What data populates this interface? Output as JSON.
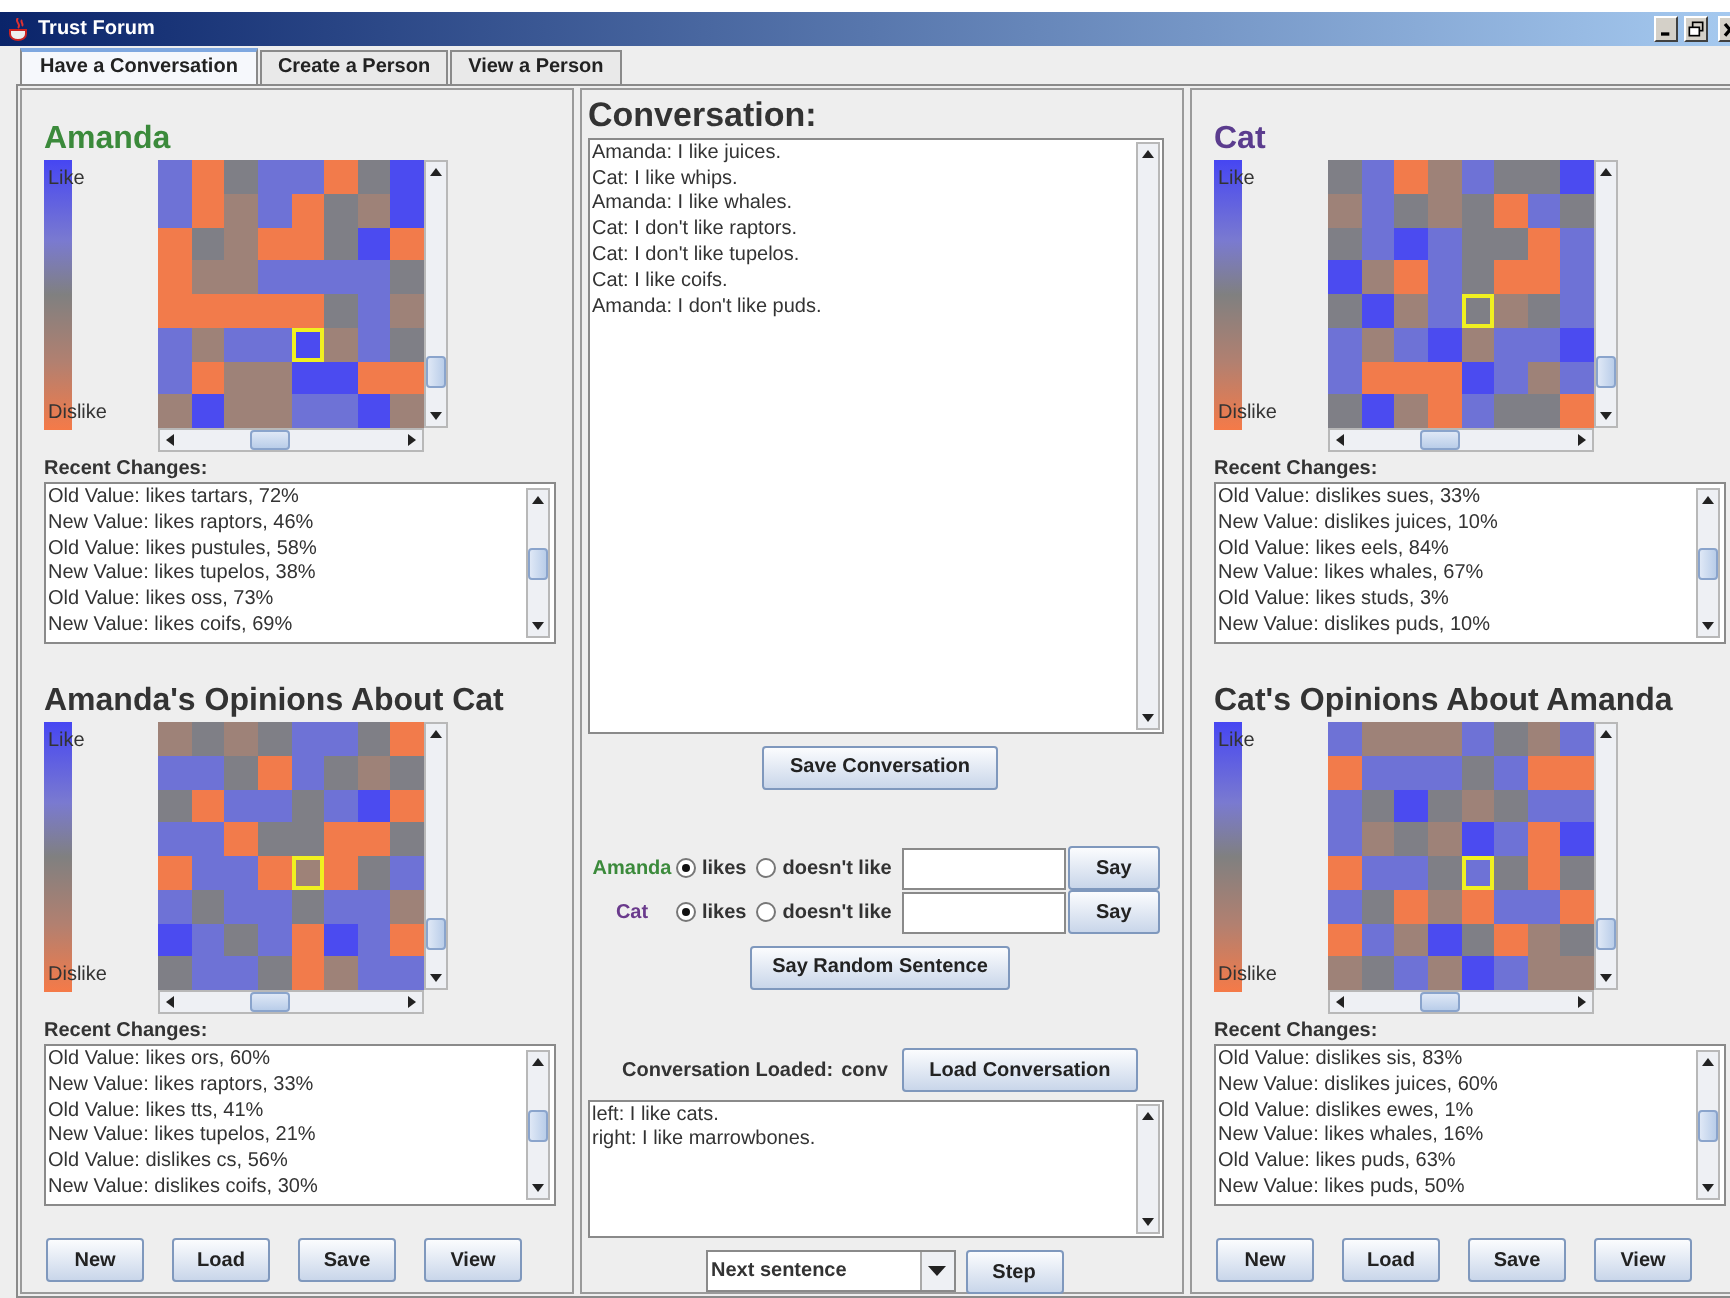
{
  "window": {
    "title": "Trust Forum"
  },
  "tabs": [
    {
      "label": "Have a Conversation",
      "selected": true
    },
    {
      "label": "Create a Person",
      "selected": false
    },
    {
      "label": "View a Person",
      "selected": false
    }
  ],
  "left_panel": {
    "color": "#3b8a3b",
    "sections": [
      {
        "kind": "self",
        "title": "Amanda",
        "legend": {
          "top": "Like",
          "bottom": "Dislike"
        },
        "grid": [
          {
            "cells": [
              {
                "color": "#6e72d6",
                "selected": false
              },
              {
                "color": "#f27b4b",
                "selected": false
              },
              {
                "color": "#7f7f86",
                "selected": false
              },
              {
                "color": "#6e72d6",
                "selected": false
              },
              {
                "color": "#6e72d6",
                "selected": false
              },
              {
                "color": "#f27b4b",
                "selected": false
              },
              {
                "color": "#7f7f86",
                "selected": false
              },
              {
                "color": "#4b4bf0",
                "selected": false
              }
            ]
          },
          {
            "cells": [
              {
                "color": "#6e72d6",
                "selected": false
              },
              {
                "color": "#f27b4b",
                "selected": false
              },
              {
                "color": "#9e8278",
                "selected": false
              },
              {
                "color": "#6e72d6",
                "selected": false
              },
              {
                "color": "#f27b4b",
                "selected": false
              },
              {
                "color": "#7f7f86",
                "selected": false
              },
              {
                "color": "#9e8278",
                "selected": false
              },
              {
                "color": "#4b4bf0",
                "selected": false
              }
            ]
          },
          {
            "cells": [
              {
                "color": "#f27b4b",
                "selected": false
              },
              {
                "color": "#7f7f86",
                "selected": false
              },
              {
                "color": "#9e8278",
                "selected": false
              },
              {
                "color": "#f27b4b",
                "selected": false
              },
              {
                "color": "#f27b4b",
                "selected": false
              },
              {
                "color": "#7f7f86",
                "selected": false
              },
              {
                "color": "#4b4bf0",
                "selected": false
              },
              {
                "color": "#f27b4b",
                "selected": false
              }
            ]
          },
          {
            "cells": [
              {
                "color": "#f27b4b",
                "selected": false
              },
              {
                "color": "#9e8278",
                "selected": false
              },
              {
                "color": "#9e8278",
                "selected": false
              },
              {
                "color": "#6e72d6",
                "selected": false
              },
              {
                "color": "#6e72d6",
                "selected": false
              },
              {
                "color": "#6e72d6",
                "selected": false
              },
              {
                "color": "#6e72d6",
                "selected": false
              },
              {
                "color": "#7f7f86",
                "selected": false
              }
            ]
          },
          {
            "cells": [
              {
                "color": "#f27b4b",
                "selected": false
              },
              {
                "color": "#f27b4b",
                "selected": false
              },
              {
                "color": "#f27b4b",
                "selected": false
              },
              {
                "color": "#f27b4b",
                "selected": false
              },
              {
                "color": "#f27b4b",
                "selected": false
              },
              {
                "color": "#7f7f86",
                "selected": false
              },
              {
                "color": "#6e72d6",
                "selected": false
              },
              {
                "color": "#9e8278",
                "selected": false
              }
            ]
          },
          {
            "cells": [
              {
                "color": "#6e72d6",
                "selected": false
              },
              {
                "color": "#9e8278",
                "selected": false
              },
              {
                "color": "#6e72d6",
                "selected": false
              },
              {
                "color": "#6e72d6",
                "selected": false
              },
              {
                "color": "#4b4bf0",
                "selected": true
              },
              {
                "color": "#9e8278",
                "selected": false
              },
              {
                "color": "#6e72d6",
                "selected": false
              },
              {
                "color": "#7f7f86",
                "selected": false
              }
            ]
          },
          {
            "cells": [
              {
                "color": "#6e72d6",
                "selected": false
              },
              {
                "color": "#f27b4b",
                "selected": false
              },
              {
                "color": "#9e8278",
                "selected": false
              },
              {
                "color": "#9e8278",
                "selected": false
              },
              {
                "color": "#4b4bf0",
                "selected": false
              },
              {
                "color": "#4b4bf0",
                "selected": false
              },
              {
                "color": "#f27b4b",
                "selected": false
              },
              {
                "color": "#f27b4b",
                "selected": false
              }
            ]
          },
          {
            "cells": [
              {
                "color": "#9e8278",
                "selected": false
              },
              {
                "color": "#4b4bf0",
                "selected": false
              },
              {
                "color": "#9e8278",
                "selected": false
              },
              {
                "color": "#9e8278",
                "selected": false
              },
              {
                "color": "#6e72d6",
                "selected": false
              },
              {
                "color": "#6e72d6",
                "selected": false
              },
              {
                "color": "#4b4bf0",
                "selected": false
              },
              {
                "color": "#9e8278",
                "selected": false
              }
            ]
          }
        ],
        "changes_label": "Recent Changes:",
        "changes": [
          "Old Value: likes tartars, 72%",
          "New Value: likes raptors, 46%",
          "Old Value: likes pustules, 58%",
          "New Value: likes tupelos, 38%",
          "Old Value: likes oss, 73%",
          "New Value: likes coifs, 69%"
        ]
      },
      {
        "kind": "opinions",
        "title": "Amanda's Opinions About Cat",
        "legend": {
          "top": "Like",
          "bottom": "Dislike"
        },
        "grid": [
          {
            "cells": [
              {
                "color": "#9e8278",
                "selected": false
              },
              {
                "color": "#7f7f86",
                "selected": false
              },
              {
                "color": "#9e8278",
                "selected": false
              },
              {
                "color": "#7f7f86",
                "selected": false
              },
              {
                "color": "#6e72d6",
                "selected": false
              },
              {
                "color": "#6e72d6",
                "selected": false
              },
              {
                "color": "#7f7f86",
                "selected": false
              },
              {
                "color": "#f27b4b",
                "selected": false
              }
            ]
          },
          {
            "cells": [
              {
                "color": "#6e72d6",
                "selected": false
              },
              {
                "color": "#6e72d6",
                "selected": false
              },
              {
                "color": "#7f7f86",
                "selected": false
              },
              {
                "color": "#f27b4b",
                "selected": false
              },
              {
                "color": "#6e72d6",
                "selected": false
              },
              {
                "color": "#7f7f86",
                "selected": false
              },
              {
                "color": "#9e8278",
                "selected": false
              },
              {
                "color": "#7f7f86",
                "selected": false
              }
            ]
          },
          {
            "cells": [
              {
                "color": "#7f7f86",
                "selected": false
              },
              {
                "color": "#f27b4b",
                "selected": false
              },
              {
                "color": "#6e72d6",
                "selected": false
              },
              {
                "color": "#6e72d6",
                "selected": false
              },
              {
                "color": "#7f7f86",
                "selected": false
              },
              {
                "color": "#6e72d6",
                "selected": false
              },
              {
                "color": "#4b4bf0",
                "selected": false
              },
              {
                "color": "#f27b4b",
                "selected": false
              }
            ]
          },
          {
            "cells": [
              {
                "color": "#6e72d6",
                "selected": false
              },
              {
                "color": "#6e72d6",
                "selected": false
              },
              {
                "color": "#f27b4b",
                "selected": false
              },
              {
                "color": "#7f7f86",
                "selected": false
              },
              {
                "color": "#7f7f86",
                "selected": false
              },
              {
                "color": "#f27b4b",
                "selected": false
              },
              {
                "color": "#f27b4b",
                "selected": false
              },
              {
                "color": "#7f7f86",
                "selected": false
              }
            ]
          },
          {
            "cells": [
              {
                "color": "#f27b4b",
                "selected": false
              },
              {
                "color": "#6e72d6",
                "selected": false
              },
              {
                "color": "#6e72d6",
                "selected": false
              },
              {
                "color": "#f27b4b",
                "selected": false
              },
              {
                "color": "#9e8278",
                "selected": true
              },
              {
                "color": "#f27b4b",
                "selected": false
              },
              {
                "color": "#7f7f86",
                "selected": false
              },
              {
                "color": "#6e72d6",
                "selected": false
              }
            ]
          },
          {
            "cells": [
              {
                "color": "#6e72d6",
                "selected": false
              },
              {
                "color": "#7f7f86",
                "selected": false
              },
              {
                "color": "#6e72d6",
                "selected": false
              },
              {
                "color": "#6e72d6",
                "selected": false
              },
              {
                "color": "#7f7f86",
                "selected": false
              },
              {
                "color": "#6e72d6",
                "selected": false
              },
              {
                "color": "#6e72d6",
                "selected": false
              },
              {
                "color": "#9e8278",
                "selected": false
              }
            ]
          },
          {
            "cells": [
              {
                "color": "#4b4bf0",
                "selected": false
              },
              {
                "color": "#6e72d6",
                "selected": false
              },
              {
                "color": "#7f7f86",
                "selected": false
              },
              {
                "color": "#6e72d6",
                "selected": false
              },
              {
                "color": "#f27b4b",
                "selected": false
              },
              {
                "color": "#4b4bf0",
                "selected": false
              },
              {
                "color": "#6e72d6",
                "selected": false
              },
              {
                "color": "#f27b4b",
                "selected": false
              }
            ]
          },
          {
            "cells": [
              {
                "color": "#7f7f86",
                "selected": false
              },
              {
                "color": "#6e72d6",
                "selected": false
              },
              {
                "color": "#6e72d6",
                "selected": false
              },
              {
                "color": "#7f7f86",
                "selected": false
              },
              {
                "color": "#f27b4b",
                "selected": false
              },
              {
                "color": "#9e8278",
                "selected": false
              },
              {
                "color": "#6e72d6",
                "selected": false
              },
              {
                "color": "#6e72d6",
                "selected": false
              }
            ]
          }
        ],
        "changes_label": "Recent Changes:",
        "changes": [
          "Old Value: likes ors, 60%",
          "New Value: likes raptors, 33%",
          "Old Value: likes tts, 41%",
          "New Value: likes tupelos, 21%",
          "Old Value: dislikes cs, 56%",
          "New Value: dislikes coifs, 30%"
        ]
      }
    ],
    "buttons": [
      "New",
      "Load",
      "Save",
      "View"
    ]
  },
  "center_panel": {
    "title": "Conversation:",
    "lines": [
      "Amanda: I like juices.",
      "Cat: I like whips.",
      "Amanda: I like whales.",
      "Cat: I don't like raptors.",
      "Cat: I don't like tupelos.",
      "Cat: I like coifs.",
      "Amanda: I don't like puds."
    ],
    "save_button": "Save Conversation",
    "speakers": [
      {
        "name": "Amanda",
        "color": "#3b8a3b",
        "options": [
          {
            "label": "likes",
            "selected": true
          },
          {
            "label": "doesn't like",
            "selected": false
          }
        ],
        "button": "Say"
      },
      {
        "name": "Cat",
        "color": "#6a3a8c",
        "options": [
          {
            "label": "likes",
            "selected": true
          },
          {
            "label": "doesn't like",
            "selected": false
          }
        ],
        "button": "Say"
      }
    ],
    "random_button": "Say Random Sentence",
    "loaded_label": "Conversation Loaded:",
    "loaded_value": "conv",
    "load_button": "Load Conversation",
    "script_lines": [
      "left: I  like cats.",
      "right: I  like marrowbones."
    ],
    "step_dropdown": "Next sentence",
    "step_button": "Step"
  },
  "right_panel": {
    "color": "#5b3c8e",
    "sections": [
      {
        "kind": "self",
        "title": "Cat",
        "legend": {
          "top": "Like",
          "bottom": "Dislike"
        },
        "grid": [
          {
            "cells": [
              {
                "color": "#7f7f86",
                "selected": false
              },
              {
                "color": "#6e72d6",
                "selected": false
              },
              {
                "color": "#f27b4b",
                "selected": false
              },
              {
                "color": "#9e8278",
                "selected": false
              },
              {
                "color": "#6e72d6",
                "selected": false
              },
              {
                "color": "#7f7f86",
                "selected": false
              },
              {
                "color": "#7f7f86",
                "selected": false
              },
              {
                "color": "#4b4bf0",
                "selected": false
              }
            ]
          },
          {
            "cells": [
              {
                "color": "#9e8278",
                "selected": false
              },
              {
                "color": "#6e72d6",
                "selected": false
              },
              {
                "color": "#7f7f86",
                "selected": false
              },
              {
                "color": "#9e8278",
                "selected": false
              },
              {
                "color": "#7f7f86",
                "selected": false
              },
              {
                "color": "#f27b4b",
                "selected": false
              },
              {
                "color": "#6e72d6",
                "selected": false
              },
              {
                "color": "#7f7f86",
                "selected": false
              }
            ]
          },
          {
            "cells": [
              {
                "color": "#7f7f86",
                "selected": false
              },
              {
                "color": "#6e72d6",
                "selected": false
              },
              {
                "color": "#4b4bf0",
                "selected": false
              },
              {
                "color": "#6e72d6",
                "selected": false
              },
              {
                "color": "#7f7f86",
                "selected": false
              },
              {
                "color": "#7f7f86",
                "selected": false
              },
              {
                "color": "#f27b4b",
                "selected": false
              },
              {
                "color": "#6e72d6",
                "selected": false
              }
            ]
          },
          {
            "cells": [
              {
                "color": "#4b4bf0",
                "selected": false
              },
              {
                "color": "#9e8278",
                "selected": false
              },
              {
                "color": "#f27b4b",
                "selected": false
              },
              {
                "color": "#6e72d6",
                "selected": false
              },
              {
                "color": "#7f7f86",
                "selected": false
              },
              {
                "color": "#f27b4b",
                "selected": false
              },
              {
                "color": "#f27b4b",
                "selected": false
              },
              {
                "color": "#6e72d6",
                "selected": false
              }
            ]
          },
          {
            "cells": [
              {
                "color": "#7f7f86",
                "selected": false
              },
              {
                "color": "#4b4bf0",
                "selected": false
              },
              {
                "color": "#9e8278",
                "selected": false
              },
              {
                "color": "#6e72d6",
                "selected": false
              },
              {
                "color": "#7f7f86",
                "selected": true
              },
              {
                "color": "#9e8278",
                "selected": false
              },
              {
                "color": "#7f7f86",
                "selected": false
              },
              {
                "color": "#6e72d6",
                "selected": false
              }
            ]
          },
          {
            "cells": [
              {
                "color": "#6e72d6",
                "selected": false
              },
              {
                "color": "#9e8278",
                "selected": false
              },
              {
                "color": "#6e72d6",
                "selected": false
              },
              {
                "color": "#4b4bf0",
                "selected": false
              },
              {
                "color": "#9e8278",
                "selected": false
              },
              {
                "color": "#6e72d6",
                "selected": false
              },
              {
                "color": "#6e72d6",
                "selected": false
              },
              {
                "color": "#4b4bf0",
                "selected": false
              }
            ]
          },
          {
            "cells": [
              {
                "color": "#6e72d6",
                "selected": false
              },
              {
                "color": "#f27b4b",
                "selected": false
              },
              {
                "color": "#f27b4b",
                "selected": false
              },
              {
                "color": "#f27b4b",
                "selected": false
              },
              {
                "color": "#4b4bf0",
                "selected": false
              },
              {
                "color": "#6e72d6",
                "selected": false
              },
              {
                "color": "#9e8278",
                "selected": false
              },
              {
                "color": "#6e72d6",
                "selected": false
              }
            ]
          },
          {
            "cells": [
              {
                "color": "#7f7f86",
                "selected": false
              },
              {
                "color": "#4b4bf0",
                "selected": false
              },
              {
                "color": "#9e8278",
                "selected": false
              },
              {
                "color": "#f27b4b",
                "selected": false
              },
              {
                "color": "#6e72d6",
                "selected": false
              },
              {
                "color": "#7f7f86",
                "selected": false
              },
              {
                "color": "#7f7f86",
                "selected": false
              },
              {
                "color": "#f27b4b",
                "selected": false
              }
            ]
          }
        ],
        "changes_label": "Recent Changes:",
        "changes": [
          "Old Value: dislikes sues, 33%",
          "New Value: dislikes juices, 10%",
          "Old Value: likes eels, 84%",
          "New Value: likes whales, 67%",
          "Old Value: likes studs, 3%",
          "New Value: dislikes puds, 10%"
        ]
      },
      {
        "kind": "opinions",
        "title": "Cat's Opinions About Amanda",
        "legend": {
          "top": "Like",
          "bottom": "Dislike"
        },
        "grid": [
          {
            "cells": [
              {
                "color": "#6e72d6",
                "selected": false
              },
              {
                "color": "#9e8278",
                "selected": false
              },
              {
                "color": "#9e8278",
                "selected": false
              },
              {
                "color": "#9e8278",
                "selected": false
              },
              {
                "color": "#6e72d6",
                "selected": false
              },
              {
                "color": "#7f7f86",
                "selected": false
              },
              {
                "color": "#9e8278",
                "selected": false
              },
              {
                "color": "#6e72d6",
                "selected": false
              }
            ]
          },
          {
            "cells": [
              {
                "color": "#f27b4b",
                "selected": false
              },
              {
                "color": "#6e72d6",
                "selected": false
              },
              {
                "color": "#6e72d6",
                "selected": false
              },
              {
                "color": "#6e72d6",
                "selected": false
              },
              {
                "color": "#7f7f86",
                "selected": false
              },
              {
                "color": "#6e72d6",
                "selected": false
              },
              {
                "color": "#f27b4b",
                "selected": false
              },
              {
                "color": "#f27b4b",
                "selected": false
              }
            ]
          },
          {
            "cells": [
              {
                "color": "#6e72d6",
                "selected": false
              },
              {
                "color": "#7f7f86",
                "selected": false
              },
              {
                "color": "#4b4bf0",
                "selected": false
              },
              {
                "color": "#7f7f86",
                "selected": false
              },
              {
                "color": "#9e8278",
                "selected": false
              },
              {
                "color": "#7f7f86",
                "selected": false
              },
              {
                "color": "#6e72d6",
                "selected": false
              },
              {
                "color": "#6e72d6",
                "selected": false
              }
            ]
          },
          {
            "cells": [
              {
                "color": "#6e72d6",
                "selected": false
              },
              {
                "color": "#9e8278",
                "selected": false
              },
              {
                "color": "#7f7f86",
                "selected": false
              },
              {
                "color": "#9e8278",
                "selected": false
              },
              {
                "color": "#4b4bf0",
                "selected": false
              },
              {
                "color": "#6e72d6",
                "selected": false
              },
              {
                "color": "#f27b4b",
                "selected": false
              },
              {
                "color": "#4b4bf0",
                "selected": false
              }
            ]
          },
          {
            "cells": [
              {
                "color": "#f27b4b",
                "selected": false
              },
              {
                "color": "#6e72d6",
                "selected": false
              },
              {
                "color": "#6e72d6",
                "selected": false
              },
              {
                "color": "#7f7f86",
                "selected": false
              },
              {
                "color": "#6e72d6",
                "selected": true
              },
              {
                "color": "#7f7f86",
                "selected": false
              },
              {
                "color": "#f27b4b",
                "selected": false
              },
              {
                "color": "#7f7f86",
                "selected": false
              }
            ]
          },
          {
            "cells": [
              {
                "color": "#6e72d6",
                "selected": false
              },
              {
                "color": "#7f7f86",
                "selected": false
              },
              {
                "color": "#f27b4b",
                "selected": false
              },
              {
                "color": "#9e8278",
                "selected": false
              },
              {
                "color": "#f27b4b",
                "selected": false
              },
              {
                "color": "#6e72d6",
                "selected": false
              },
              {
                "color": "#6e72d6",
                "selected": false
              },
              {
                "color": "#f27b4b",
                "selected": false
              }
            ]
          },
          {
            "cells": [
              {
                "color": "#f27b4b",
                "selected": false
              },
              {
                "color": "#6e72d6",
                "selected": false
              },
              {
                "color": "#9e8278",
                "selected": false
              },
              {
                "color": "#4b4bf0",
                "selected": false
              },
              {
                "color": "#7f7f86",
                "selected": false
              },
              {
                "color": "#f27b4b",
                "selected": false
              },
              {
                "color": "#9e8278",
                "selected": false
              },
              {
                "color": "#7f7f86",
                "selected": false
              }
            ]
          },
          {
            "cells": [
              {
                "color": "#9e8278",
                "selected": false
              },
              {
                "color": "#7f7f86",
                "selected": false
              },
              {
                "color": "#6e72d6",
                "selected": false
              },
              {
                "color": "#9e8278",
                "selected": false
              },
              {
                "color": "#4b4bf0",
                "selected": false
              },
              {
                "color": "#6e72d6",
                "selected": false
              },
              {
                "color": "#9e8278",
                "selected": false
              },
              {
                "color": "#9e8278",
                "selected": false
              }
            ]
          }
        ],
        "changes_label": "Recent Changes:",
        "changes": [
          "Old Value: dislikes sis, 83%",
          "New Value: dislikes juices, 60%",
          "Old Value: dislikes ewes, 1%",
          "New Value: likes whales, 16%",
          "Old Value: likes puds, 63%",
          "New Value: likes puds, 50%"
        ]
      }
    ],
    "buttons": [
      "New",
      "Load",
      "Save",
      "View"
    ]
  }
}
